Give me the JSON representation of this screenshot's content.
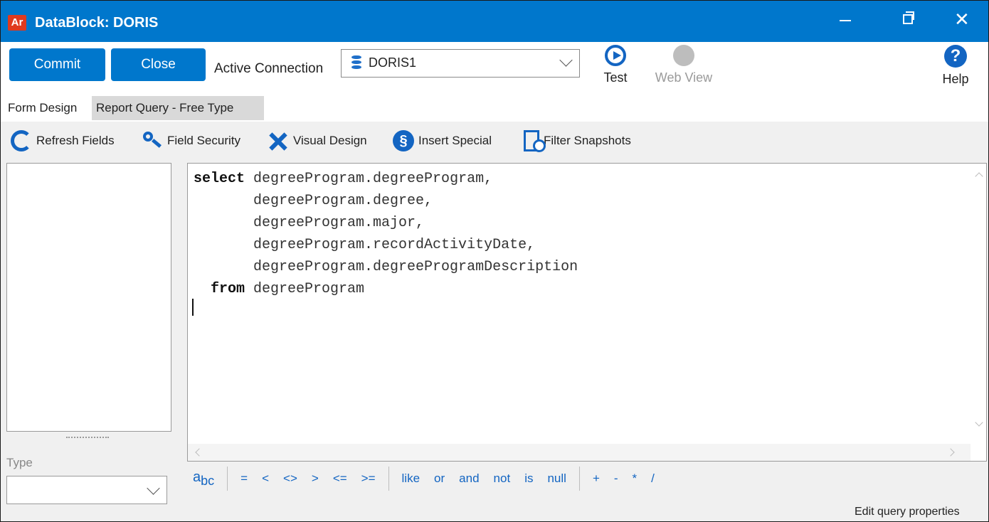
{
  "window": {
    "app_logo": "Ar",
    "title": "DataBlock: DORIS"
  },
  "toolbar": {
    "commit_label": "Commit",
    "close_label": "Close",
    "connection_label": "Active Connection",
    "connection_value": "DORIS1",
    "test_label": "Test",
    "web_view_label": "Web View",
    "help_label": "Help"
  },
  "tabs": [
    {
      "label": "Form Design",
      "active": false
    },
    {
      "label": "Report Query - Free Type",
      "active": true
    }
  ],
  "field_toolbar": {
    "refresh": "Refresh Fields",
    "security": "Field Security",
    "visual": "Visual Design",
    "special": "Insert Special",
    "special_icon_glyph": "§",
    "filter": "Filter Snapshots"
  },
  "query": {
    "lines": [
      {
        "kw": "select",
        "text": " degreeProgram.degreeProgram,"
      },
      {
        "kw": "",
        "text": "       degreeProgram.degree,"
      },
      {
        "kw": "",
        "text": "       degreeProgram.major,"
      },
      {
        "kw": "",
        "text": "       degreeProgram.recordActivityDate,"
      },
      {
        "kw": "",
        "text": "       degreeProgram.degreeProgramDescription"
      },
      {
        "kw": "  from",
        "text": " degreeProgram"
      }
    ]
  },
  "left_panel": {
    "type_label": "Type",
    "type_value": ""
  },
  "operators": {
    "abc": "a b c",
    "group1": [
      "=",
      "<",
      "<>",
      ">",
      "<=",
      ">="
    ],
    "group2": [
      "like",
      "or",
      "and",
      "not",
      "is",
      "null"
    ],
    "group3": [
      "+",
      "-",
      "*",
      "/"
    ]
  },
  "footer": {
    "edit_properties": "Edit query properties"
  },
  "colors": {
    "accent": "#0077cc",
    "icon_blue": "#1365c2"
  }
}
